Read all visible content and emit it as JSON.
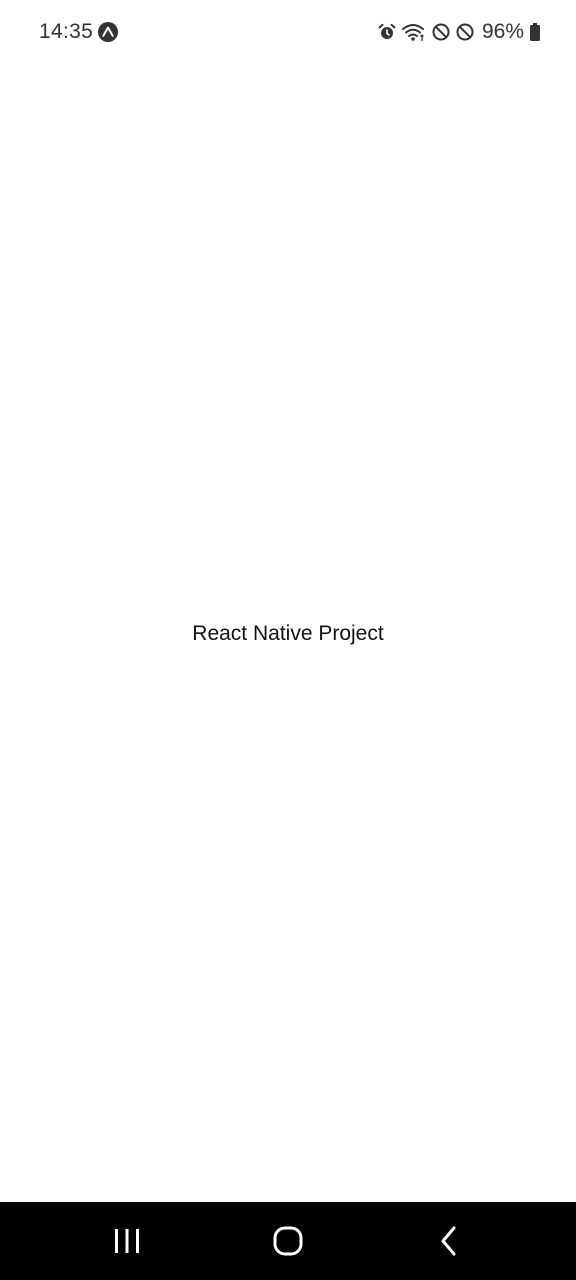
{
  "status_bar": {
    "time": "14:35",
    "battery_percent": "96%",
    "icons": [
      "expo-icon",
      "alarm-icon",
      "wifi-icon",
      "do-not-disturb-icon",
      "blocked-icon",
      "battery-icon"
    ]
  },
  "main": {
    "title": "React Native Project"
  },
  "nav_bar": {
    "buttons": [
      "recents",
      "home",
      "back"
    ]
  },
  "colors": {
    "background": "#ffffff",
    "nav_background": "#000000",
    "status_text": "#333333"
  }
}
